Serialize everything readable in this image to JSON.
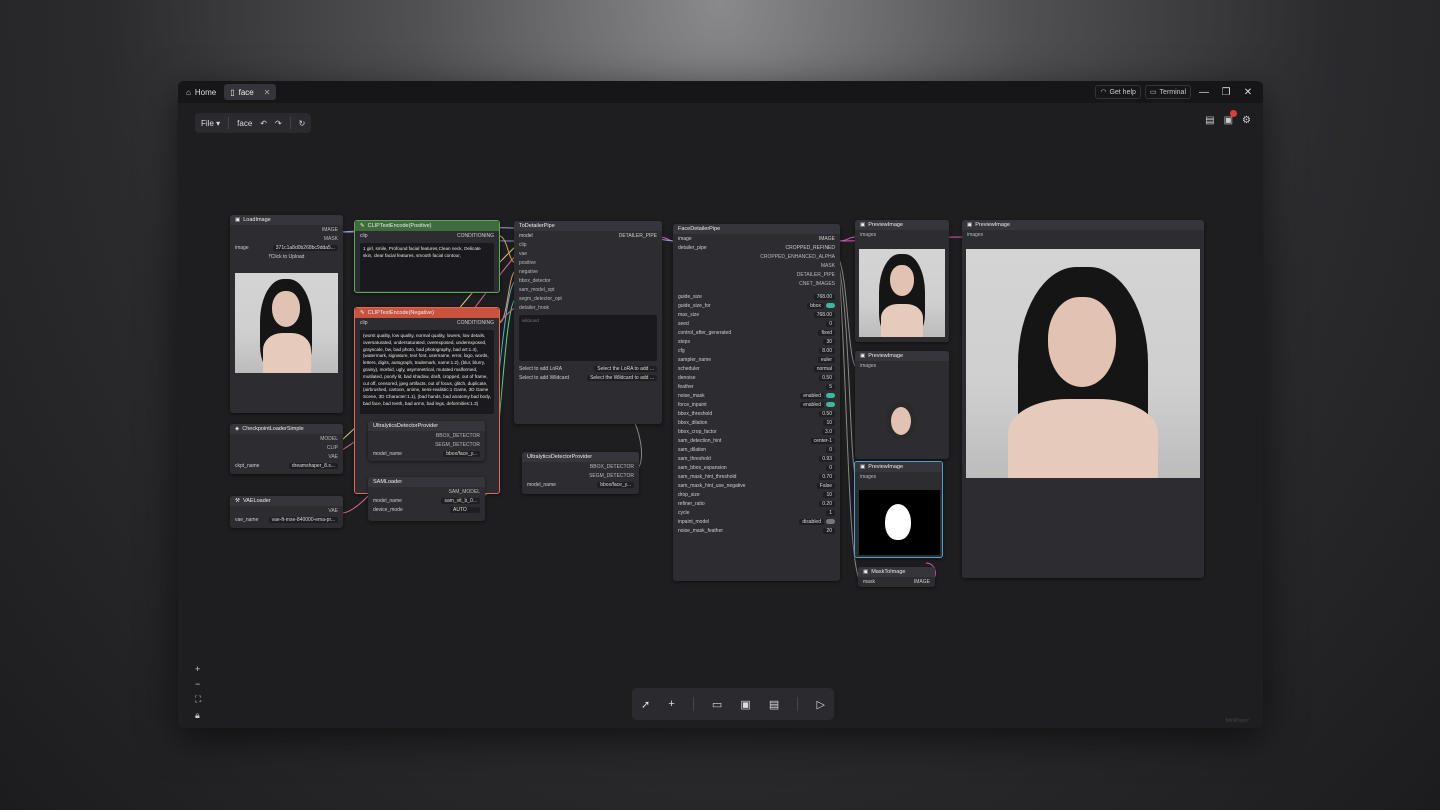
{
  "titlebar": {
    "home_label": "Home",
    "tab_label": "face",
    "get_help": "Get help",
    "terminal": "Terminal"
  },
  "toolbar": {
    "file": "File",
    "workflow": "face"
  },
  "nodes": {
    "load_image": {
      "title": "LoadImage",
      "outputs": [
        "IMAGE",
        "MASK"
      ],
      "image_label": "image",
      "image_value": "371c1a8d0b268bc9dda5...",
      "upload": "Click to Upload"
    },
    "clip_pos": {
      "title": "CLIPTextEncode(Positive)",
      "input": "clip",
      "output": "CONDITIONING",
      "text": "1 girl,   smile,   Profound facial features,Clean neck,   Delicate skin,   clear facial features, smooth facial contour,"
    },
    "clip_neg": {
      "title": "CLIPTextEncode(Negative)",
      "input": "clip",
      "output": "CONDITIONING",
      "text": "(worst quality, low quality, normal quality, lowres, low details, oversaturated, undersaturated, overexposed, underexposed, grayscale, bw, bad photo, bad photography, bad art:1.4), (watermark, signature, text font, username, error, logo, words, letters, digits, autograph, trademark, name:1.2), (blur, blurry, grainy), morbid, ugly, asymmetrical, mutated malformed, mutilated, poorly lit, bad shadow, draft, cropped, out of frame, cut off, censored, jpeg artifacts, out of focus, glitch, duplicate, (airbrushed, cartoon, anime, semi-realistic:1 Game, 3D Game Scene, 3D Character:1.1), (bad hands, bad anatomy bad body, bad face, bad teeth, bad arms, bad legs, deformities:1.3)"
    },
    "to_detailer": {
      "title": "ToDetailerPipe",
      "inputs": [
        "model",
        "clip",
        "vae",
        "positive",
        "negative",
        "bbox_detector",
        "sam_model_opt",
        "segm_detector_opt",
        "detailer_hook"
      ],
      "output": "DETAILER_PIPE",
      "wildcard": "wildcard",
      "lora_label": "Select to add LoRA",
      "lora_value": "Select the LoRA to add ...",
      "wild_label": "Select to add Wildcard",
      "wild_value": "Select the Wildcard to add ..."
    },
    "face_detailer": {
      "title": "FaceDetailerPipe",
      "inputs": [
        "image",
        "detailer_pipe"
      ],
      "outputs": [
        "IMAGE",
        "CROPPED_REFINED",
        "CROPPED_ENHANCED_ALPHA",
        "MASK",
        "DETAILER_PIPE",
        "CNET_IMAGES"
      ],
      "params": [
        [
          "guide_size",
          "768.00"
        ],
        [
          "guide_size_for",
          "bbox"
        ],
        [
          "max_size",
          "768.00"
        ],
        [
          "seed",
          "0"
        ],
        [
          "control_after_generated",
          "fixed"
        ],
        [
          "steps",
          "30"
        ],
        [
          "cfg",
          "8.00"
        ],
        [
          "sampler_name",
          "euler"
        ],
        [
          "scheduler",
          "normal"
        ],
        [
          "denoise",
          "0.50"
        ],
        [
          "feather",
          "5"
        ],
        [
          "noise_mask",
          "enabled"
        ],
        [
          "force_inpaint",
          "enabled"
        ],
        [
          "bbox_threshold",
          "0.50"
        ],
        [
          "bbox_dilation",
          "10"
        ],
        [
          "bbox_crop_factor",
          "3.0"
        ],
        [
          "sam_detection_hint",
          "center-1"
        ],
        [
          "sam_dilation",
          "0"
        ],
        [
          "sam_threshold",
          "0.93"
        ],
        [
          "sam_bbox_expansion",
          "0"
        ],
        [
          "sam_mask_hint_threshold",
          "0.70"
        ],
        [
          "sam_mask_hint_use_negative",
          "False"
        ],
        [
          "drop_size",
          "10"
        ],
        [
          "refiner_ratio",
          "0.20"
        ],
        [
          "cycle",
          "1"
        ],
        [
          "inpaint_model",
          "disabled"
        ],
        [
          "noise_mask_feather",
          "20"
        ]
      ]
    },
    "checkpoint": {
      "title": "CheckpointLoaderSimple",
      "outputs": [
        "MODEL",
        "CLIP",
        "VAE"
      ],
      "label": "ckpt_name",
      "value": "dreamshaper_8.s..."
    },
    "vae": {
      "title": "VAELoader",
      "output": "VAE",
      "label": "vae_name",
      "value": "vae-ft-mse-840000-ema-pr..."
    },
    "ultra1": {
      "title": "UltralyticsDetectorProvider",
      "outputs": [
        "BBOX_DETECTOR",
        "SEGM_DETECTOR"
      ],
      "label": "model_name",
      "value": "bbox/face_y..."
    },
    "ultra2": {
      "title": "UltralyticsDetectorProvider",
      "outputs": [
        "BBOX_DETECTOR",
        "SEGM_DETECTOR"
      ],
      "label": "model_name",
      "value": "bbox/face_y..."
    },
    "sam": {
      "title": "SAMLoader",
      "output": "SAM_MODEL",
      "model_label": "model_name",
      "model_value": "sam_vit_b_0...",
      "device_label": "device_mode",
      "device_value": "AUTO"
    },
    "preview1": {
      "title": "PreviewImage",
      "input": "images"
    },
    "preview2": {
      "title": "PreviewImage",
      "input": "images"
    },
    "preview3": {
      "title": "PreviewImage",
      "input": "images"
    },
    "preview4": {
      "title": "PreviewImage",
      "input": "images"
    },
    "mask_to_image": {
      "title": "MaskToImage",
      "input": "mask",
      "output": "IMAGE"
    }
  },
  "watermark": "MiniPlayer",
  "colors": {
    "accent": "#3db89e",
    "positive": "#3f6b3f",
    "negative": "#c9533f",
    "alert": "#e03a3a"
  }
}
